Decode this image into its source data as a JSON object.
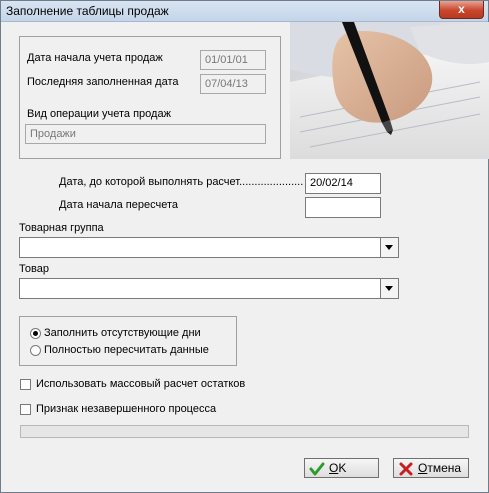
{
  "window": {
    "title": "Заполнение таблицы продаж",
    "close_glyph": "x"
  },
  "info": {
    "start_date_label": "Дата начала учета продаж",
    "start_date_value": "01/01/01",
    "last_filled_label": "Последняя заполненная дата",
    "last_filled_value": "07/04/13",
    "operation_label": "Вид операции учета продаж",
    "operation_value": "Продажи"
  },
  "calc": {
    "until_date_label": "Дата, до которой выполнять расчет........................",
    "until_date_value": "20/02/14",
    "recalc_start_label": "Дата начала пересчета",
    "recalc_start_value": ""
  },
  "filters": {
    "product_group_label": "Товарная группа",
    "product_group_value": "",
    "product_label": "Товар",
    "product_value": ""
  },
  "mode": {
    "options": [
      {
        "label": "Заполнить отсутствующие дни",
        "selected": true
      },
      {
        "label": "Полностью пересчитать данные",
        "selected": false
      }
    ]
  },
  "checks": {
    "mass_calc_label": "Использовать массовый расчет остатков",
    "mass_calc_checked": false,
    "incomplete_label": "Признак незавершенного процесса",
    "incomplete_checked": false
  },
  "progress": {
    "value": 0
  },
  "buttons": {
    "ok_accel": "O",
    "ok_rest": "K",
    "cancel_accel": "О",
    "cancel_rest": "тмена"
  },
  "icons": {
    "ok": "check-icon",
    "cancel": "x-icon",
    "dropdown": "chevron-down-icon"
  },
  "colors": {
    "ok_icon": "#2e9b2e",
    "cancel_icon": "#c81e1e",
    "titlebar": "#c4d5ea",
    "close_button": "#c9462c"
  }
}
